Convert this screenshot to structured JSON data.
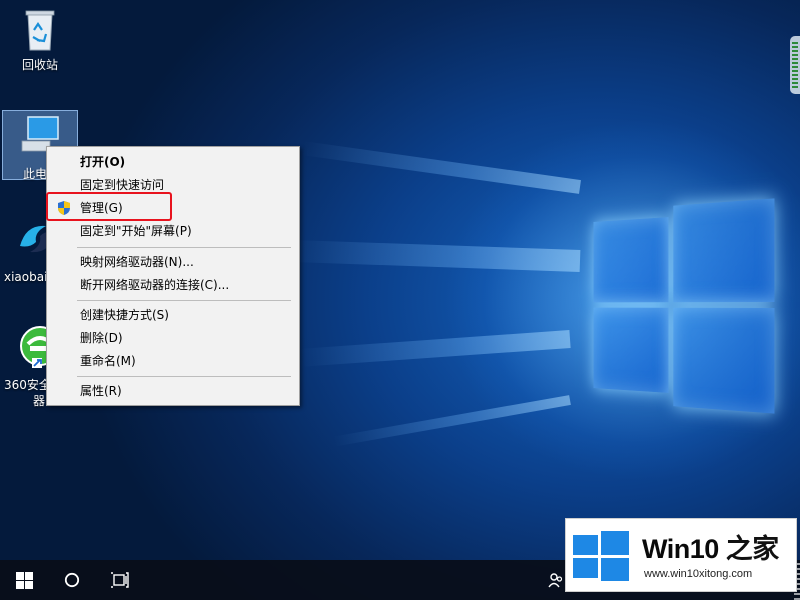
{
  "desktop": {
    "icons": [
      {
        "id": "recycle-bin",
        "label": "回收站",
        "icon": "recycle-bin-icon"
      },
      {
        "id": "this-pc",
        "label": "此电脑",
        "icon": "computer-icon",
        "selected": true
      },
      {
        "id": "xiaobai",
        "label": "xiaobai",
        "icon": "xiaobai-icon"
      },
      {
        "id": "360",
        "label_line1": "360安全",
        "label_line2": "器",
        "icon": "360-safe-icon"
      }
    ]
  },
  "context_menu": {
    "items": [
      {
        "id": "open",
        "label": "打开(O)",
        "bold": true
      },
      {
        "id": "pin-quick-access",
        "label": "固定到快速访问"
      },
      {
        "id": "manage",
        "label": "管理(G)",
        "icon": "uac-shield-icon",
        "highlighted": true
      },
      {
        "id": "pin-start",
        "label": "固定到\"开始\"屏幕(P)"
      },
      {
        "id": "map-drive",
        "label": "映射网络驱动器(N)..."
      },
      {
        "id": "disconnect-drive",
        "label": "断开网络驱动器的连接(C)..."
      },
      {
        "id": "create-shortcut",
        "label": "创建快捷方式(S)"
      },
      {
        "id": "delete",
        "label": "删除(D)"
      },
      {
        "id": "rename",
        "label": "重命名(M)"
      },
      {
        "id": "properties",
        "label": "属性(R)"
      }
    ]
  },
  "taskbar": {
    "start_icon": "windows-start-icon",
    "search_icon": "cortana-circle-icon",
    "task_view_icon": "task-view-icon",
    "people_icon": "people-icon"
  },
  "watermark": {
    "brand": "Win10",
    "brand_zh": "之家",
    "url": "www.win10xitong.com"
  },
  "colors": {
    "highlight_border": "#e8131e",
    "menu_background": "#f2f2f2",
    "taskbar": "#080e1a",
    "desktop_accent": "#1566c4"
  }
}
